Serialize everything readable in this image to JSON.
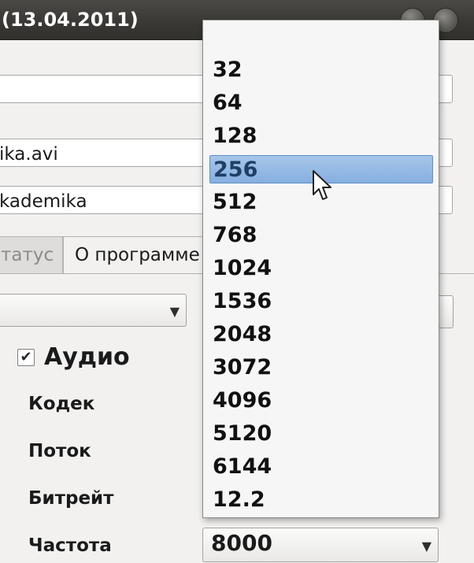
{
  "window": {
    "title": "(13.04.2011)"
  },
  "fields": {
    "input_name": "ika.avi",
    "output_name": "kademika"
  },
  "tabs": [
    {
      "label": "татус",
      "active": false
    },
    {
      "label": "О программе",
      "active": true
    }
  ],
  "audio": {
    "section_label": "Аудио",
    "enabled": true,
    "rows": [
      {
        "label": "Кодек"
      },
      {
        "label": "Поток"
      },
      {
        "label": "Битрейт"
      },
      {
        "label": "Частота"
      }
    ],
    "frequency_value": "8000"
  },
  "bitrate_dropdown": {
    "options": [
      "32",
      "64",
      "128",
      "256",
      "512",
      "768",
      "1024",
      "1536",
      "2048",
      "3072",
      "4096",
      "5120",
      "6144",
      "12.2"
    ],
    "selected": "256"
  },
  "colors": {
    "titlebar": "#3a3935",
    "selection": "#86afe0",
    "window_bg": "#f2f1f0"
  },
  "icons": {
    "dropdown_arrow": "▼",
    "checkbox_check": "✔"
  }
}
